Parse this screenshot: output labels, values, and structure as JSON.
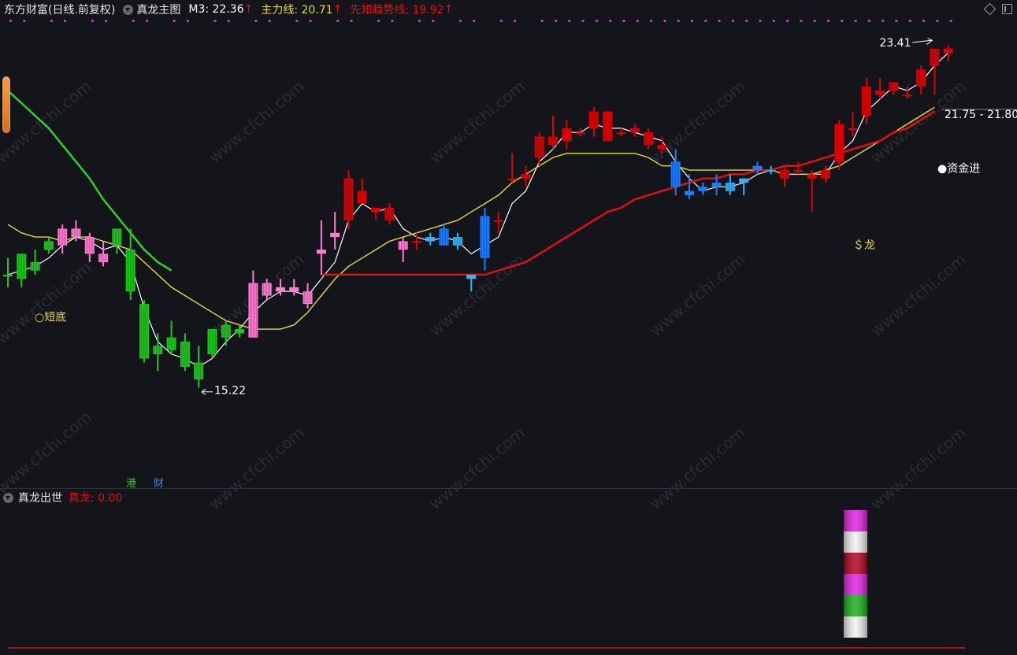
{
  "header": {
    "title": "东方财富(日线.前复权)",
    "indicator_name": "真龙主图",
    "m3": "M3: 22.36",
    "main_line": "主力线: 20.71",
    "trend_line": "先知趋势线: 19.92",
    "arrow": "↑"
  },
  "sub_panel": {
    "name": "真龙出世",
    "value": "真龙: 0.00"
  },
  "annotations": {
    "high_label": "23.41",
    "low_label": "15.22",
    "range_label": "21.75 - 21.80",
    "short_bottom": "○短底",
    "capital_in": "●资金进",
    "dragon": "＄龙",
    "hk_tag": "港",
    "fin_tag": "财"
  },
  "watermark": "www.cfchi.com",
  "colors": {
    "bg": "#14151a",
    "up_red": "#e00000",
    "down_green": "#1ec81e",
    "pink": "#ff7ad1",
    "blue": "#1e7cff",
    "cyan": "#28b4ff",
    "ma_yellow": "#e6dc32",
    "trend_red": "#e01010",
    "trend_green": "#28d228",
    "m3_white": "#ffffff",
    "magenta": "#e020e0"
  },
  "chart_data": {
    "type": "candlestick",
    "price_range": [
      14.5,
      24.0
    ],
    "candles": [
      {
        "o": 18.0,
        "h": 18.4,
        "l": 17.7,
        "c": 18.0,
        "color": "green"
      },
      {
        "o": 18.5,
        "h": 18.5,
        "l": 17.7,
        "c": 17.9,
        "color": "green"
      },
      {
        "o": 18.1,
        "h": 18.6,
        "l": 18.0,
        "c": 18.3,
        "color": "green"
      },
      {
        "o": 18.6,
        "h": 18.9,
        "l": 18.5,
        "c": 18.8,
        "color": "green"
      },
      {
        "o": 18.7,
        "h": 19.2,
        "l": 18.5,
        "c": 19.1,
        "color": "pink"
      },
      {
        "o": 19.1,
        "h": 19.3,
        "l": 18.8,
        "c": 18.9,
        "color": "pink"
      },
      {
        "o": 18.9,
        "h": 19.0,
        "l": 18.3,
        "c": 18.5,
        "color": "pink"
      },
      {
        "o": 18.5,
        "h": 18.8,
        "l": 18.2,
        "c": 18.3,
        "color": "pink"
      },
      {
        "o": 18.7,
        "h": 19.1,
        "l": 18.5,
        "c": 19.1,
        "color": "green"
      },
      {
        "o": 18.6,
        "h": 19.1,
        "l": 17.4,
        "c": 17.6,
        "color": "green"
      },
      {
        "o": 17.3,
        "h": 17.4,
        "l": 15.9,
        "c": 16.0,
        "color": "green"
      },
      {
        "o": 16.3,
        "h": 16.6,
        "l": 15.7,
        "c": 16.1,
        "color": "green"
      },
      {
        "o": 16.5,
        "h": 16.9,
        "l": 16.1,
        "c": 16.2,
        "color": "green"
      },
      {
        "o": 16.4,
        "h": 16.6,
        "l": 15.7,
        "c": 15.8,
        "color": "green"
      },
      {
        "o": 15.9,
        "h": 16.3,
        "l": 15.3,
        "c": 15.5,
        "color": "green"
      },
      {
        "o": 16.1,
        "h": 16.7,
        "l": 16.0,
        "c": 16.7,
        "color": "green"
      },
      {
        "o": 16.5,
        "h": 16.9,
        "l": 16.3,
        "c": 16.8,
        "color": "green"
      },
      {
        "o": 16.6,
        "h": 16.8,
        "l": 16.5,
        "c": 16.7,
        "color": "green"
      },
      {
        "o": 16.5,
        "h": 18.1,
        "l": 16.5,
        "c": 17.8,
        "color": "pink"
      },
      {
        "o": 17.8,
        "h": 17.9,
        "l": 17.4,
        "c": 17.5,
        "color": "pink"
      },
      {
        "o": 17.6,
        "h": 17.9,
        "l": 17.5,
        "c": 17.7,
        "color": "pink"
      },
      {
        "o": 17.7,
        "h": 17.9,
        "l": 17.5,
        "c": 17.6,
        "color": "pink"
      },
      {
        "o": 17.6,
        "h": 17.8,
        "l": 17.2,
        "c": 17.3,
        "color": "pink"
      },
      {
        "o": 18.5,
        "h": 19.3,
        "l": 18.0,
        "c": 18.6,
        "color": "pink"
      },
      {
        "o": 18.9,
        "h": 19.5,
        "l": 18.6,
        "c": 19.0,
        "color": "pink"
      },
      {
        "o": 19.3,
        "h": 20.5,
        "l": 19.1,
        "c": 20.3,
        "color": "red"
      },
      {
        "o": 20.0,
        "h": 20.3,
        "l": 19.7,
        "c": 19.7,
        "color": "red"
      },
      {
        "o": 19.5,
        "h": 19.6,
        "l": 19.3,
        "c": 19.6,
        "color": "red"
      },
      {
        "o": 19.6,
        "h": 19.7,
        "l": 19.2,
        "c": 19.3,
        "color": "red"
      },
      {
        "o": 18.8,
        "h": 18.9,
        "l": 18.3,
        "c": 18.6,
        "color": "pink"
      },
      {
        "o": 18.8,
        "h": 19.0,
        "l": 18.6,
        "c": 18.8,
        "color": "red"
      },
      {
        "o": 18.9,
        "h": 19.0,
        "l": 18.7,
        "c": 18.8,
        "color": "cyan"
      },
      {
        "o": 18.7,
        "h": 19.2,
        "l": 18.7,
        "c": 19.1,
        "color": "blue"
      },
      {
        "o": 18.9,
        "h": 19.0,
        "l": 18.6,
        "c": 18.7,
        "color": "cyan"
      },
      {
        "o": 17.9,
        "h": 18.0,
        "l": 17.6,
        "c": 18.0,
        "color": "cyan"
      },
      {
        "o": 18.4,
        "h": 19.6,
        "l": 18.1,
        "c": 19.4,
        "color": "blue"
      },
      {
        "o": 19.3,
        "h": 19.5,
        "l": 19.0,
        "c": 19.3,
        "color": "red"
      },
      {
        "o": 20.3,
        "h": 20.9,
        "l": 20.2,
        "c": 20.3,
        "color": "red"
      },
      {
        "o": 20.4,
        "h": 20.6,
        "l": 20.1,
        "c": 20.3,
        "color": "red"
      },
      {
        "o": 20.8,
        "h": 21.4,
        "l": 20.6,
        "c": 21.3,
        "color": "red"
      },
      {
        "o": 21.1,
        "h": 21.8,
        "l": 21.0,
        "c": 21.3,
        "color": "red"
      },
      {
        "o": 21.2,
        "h": 21.7,
        "l": 21.0,
        "c": 21.5,
        "color": "red"
      },
      {
        "o": 21.4,
        "h": 21.5,
        "l": 21.3,
        "c": 21.4,
        "color": "red"
      },
      {
        "o": 21.5,
        "h": 22.0,
        "l": 21.3,
        "c": 21.9,
        "color": "red"
      },
      {
        "o": 21.9,
        "h": 21.9,
        "l": 21.2,
        "c": 21.2,
        "color": "red"
      },
      {
        "o": 21.4,
        "h": 21.5,
        "l": 21.3,
        "c": 21.4,
        "color": "red"
      },
      {
        "o": 21.5,
        "h": 21.6,
        "l": 21.3,
        "c": 21.4,
        "color": "red"
      },
      {
        "o": 21.4,
        "h": 21.5,
        "l": 21.0,
        "c": 21.1,
        "color": "red"
      },
      {
        "o": 21.1,
        "h": 21.3,
        "l": 20.9,
        "c": 21.0,
        "color": "red"
      },
      {
        "o": 20.7,
        "h": 21.0,
        "l": 19.9,
        "c": 20.1,
        "color": "blue"
      },
      {
        "o": 20.0,
        "h": 20.4,
        "l": 19.8,
        "c": 19.9,
        "color": "blue"
      },
      {
        "o": 20.1,
        "h": 20.2,
        "l": 19.9,
        "c": 20.0,
        "color": "blue"
      },
      {
        "o": 20.1,
        "h": 20.4,
        "l": 19.9,
        "c": 20.2,
        "color": "blue"
      },
      {
        "o": 20.2,
        "h": 20.4,
        "l": 19.9,
        "c": 20.0,
        "color": "cyan"
      },
      {
        "o": 20.2,
        "h": 20.3,
        "l": 19.9,
        "c": 20.3,
        "color": "cyan"
      },
      {
        "o": 20.5,
        "h": 20.7,
        "l": 20.4,
        "c": 20.6,
        "color": "blue"
      },
      {
        "o": 20.5,
        "h": 20.6,
        "l": 20.4,
        "c": 20.5,
        "color": "cyan"
      },
      {
        "o": 20.5,
        "h": 20.6,
        "l": 20.1,
        "c": 20.3,
        "color": "red"
      },
      {
        "o": 20.5,
        "h": 20.7,
        "l": 20.4,
        "c": 20.5,
        "color": "red"
      },
      {
        "o": 20.4,
        "h": 20.5,
        "l": 19.5,
        "c": 20.3,
        "color": "red"
      },
      {
        "o": 20.3,
        "h": 20.6,
        "l": 20.2,
        "c": 20.5,
        "color": "red"
      },
      {
        "o": 20.7,
        "h": 21.7,
        "l": 20.5,
        "c": 21.6,
        "color": "red"
      },
      {
        "o": 21.5,
        "h": 21.9,
        "l": 21.3,
        "c": 21.5,
        "color": "red"
      },
      {
        "o": 21.8,
        "h": 22.7,
        "l": 21.6,
        "c": 22.5,
        "color": "red"
      },
      {
        "o": 22.3,
        "h": 22.7,
        "l": 22.2,
        "c": 22.4,
        "color": "red"
      },
      {
        "o": 22.4,
        "h": 22.6,
        "l": 22.3,
        "c": 22.6,
        "color": "red"
      },
      {
        "o": 22.3,
        "h": 22.5,
        "l": 22.2,
        "c": 22.3,
        "color": "red"
      },
      {
        "o": 22.5,
        "h": 23.0,
        "l": 22.3,
        "c": 22.9,
        "color": "red"
      },
      {
        "o": 23.0,
        "h": 23.4,
        "l": 22.3,
        "c": 23.4,
        "color": "red"
      },
      {
        "o": 23.4,
        "h": 23.5,
        "l": 23.1,
        "c": 23.3,
        "color": "red"
      }
    ],
    "series": [
      {
        "name": "M3",
        "color": "#ffffff",
        "values": [
          18.0,
          18.1,
          18.2,
          18.4,
          18.7,
          18.9,
          18.8,
          18.6,
          18.7,
          18.3,
          17.2,
          16.4,
          16.1,
          16.0,
          15.8,
          16.0,
          16.4,
          16.7,
          17.1,
          17.4,
          17.6,
          17.6,
          17.5,
          17.9,
          18.3,
          19.3,
          19.7,
          19.5,
          19.6,
          19.1,
          18.9,
          18.8,
          18.9,
          18.8,
          18.5,
          18.7,
          18.9,
          19.7,
          20.0,
          20.7,
          21.0,
          21.4,
          21.4,
          21.6,
          21.5,
          21.5,
          21.4,
          21.3,
          21.2,
          20.7,
          20.3,
          20.0,
          20.1,
          20.1,
          20.2,
          20.4,
          20.5,
          20.4,
          20.4,
          20.4,
          20.4,
          20.9,
          21.2,
          21.9,
          22.2,
          22.5,
          22.4,
          22.6,
          23.0,
          23.3
        ]
      },
      {
        "name": "主力线",
        "color": "#e6dc32",
        "values": [
          19.2,
          19.0,
          18.9,
          18.9,
          18.8,
          18.9,
          18.9,
          18.8,
          18.7,
          18.6,
          18.3,
          18.0,
          17.7,
          17.5,
          17.3,
          17.1,
          16.9,
          16.8,
          16.7,
          16.7,
          16.7,
          16.8,
          17.1,
          17.5,
          17.9,
          18.2,
          18.4,
          18.6,
          18.8,
          18.9,
          19.0,
          19.1,
          19.2,
          19.3,
          19.5,
          19.7,
          19.9,
          20.2,
          20.4,
          20.6,
          20.8,
          20.9,
          20.9,
          20.9,
          20.9,
          20.9,
          20.9,
          20.8,
          20.6,
          20.6,
          20.5,
          20.5,
          20.5,
          20.5,
          20.5,
          20.5,
          20.5,
          20.4,
          20.4,
          20.4,
          20.5,
          20.6,
          20.8,
          21.0,
          21.2,
          21.4,
          21.6,
          21.8,
          22.0
        ]
      },
      {
        "name": "先知趋势线",
        "color": "#e01010",
        "values": [
          null,
          null,
          null,
          null,
          null,
          null,
          null,
          null,
          null,
          null,
          null,
          null,
          null,
          null,
          null,
          null,
          null,
          null,
          null,
          null,
          null,
          null,
          null,
          18.0,
          18.0,
          18.0,
          18.0,
          18.0,
          18.0,
          18.0,
          18.0,
          18.0,
          18.0,
          18.0,
          18.0,
          18.0,
          18.1,
          18.2,
          18.3,
          18.5,
          18.7,
          18.9,
          19.1,
          19.3,
          19.5,
          19.6,
          19.8,
          19.9,
          20.0,
          20.1,
          20.2,
          20.3,
          20.3,
          20.4,
          20.4,
          20.5,
          20.5,
          20.6,
          20.6,
          20.7,
          20.8,
          20.9,
          21.0,
          21.1,
          21.2,
          21.4,
          21.5,
          21.7,
          21.9
        ]
      },
      {
        "name": "长线",
        "color": "#28d228",
        "values": [
          22.4,
          22.1,
          21.8,
          21.5,
          21.1,
          20.7,
          20.3,
          19.8,
          19.4,
          19.0,
          18.6,
          18.3,
          18.1
        ]
      }
    ],
    "sub_chart": {
      "stack": [
        "magenta",
        "white",
        "darkred",
        "magenta",
        "green",
        "white"
      ]
    }
  }
}
